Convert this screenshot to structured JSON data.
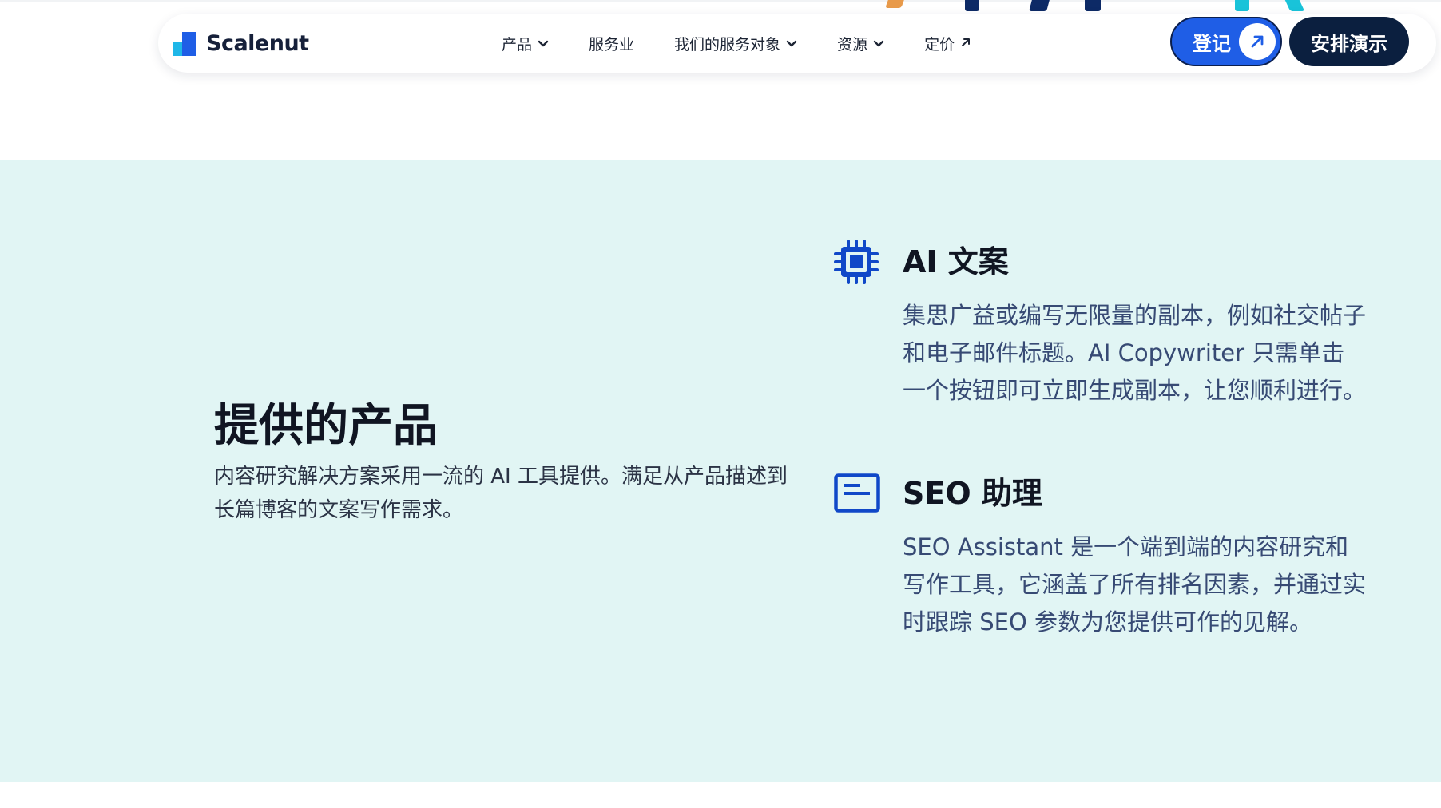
{
  "brand": {
    "name": "Scalenut",
    "accent": "#1f5ee6",
    "navy": "#0b1f3f",
    "section_bg": "#e1f5f4"
  },
  "nav": {
    "items": [
      {
        "label": "产品",
        "has_dropdown": true
      },
      {
        "label": "服务业",
        "has_dropdown": false
      },
      {
        "label": "我们的服务对象",
        "has_dropdown": true
      },
      {
        "label": "资源",
        "has_dropdown": true
      },
      {
        "label": "定价",
        "has_external_arrow": true
      }
    ],
    "login_label": "登记",
    "demo_label": "安排演示"
  },
  "section": {
    "title": "提供的产品",
    "description": "内容研究解决方案采用一流的 AI 工具提供。满足从产品描述到长篇博客的文案写作需求。",
    "features": [
      {
        "icon": "chip-icon",
        "title": "AI 文案",
        "description": "集思广益或编写无限量的副本，例如社交帖子和电子邮件标题。AI Copywriter 只需单击一个按钮即可立即生成副本，让您顺利进行。"
      },
      {
        "icon": "document-icon",
        "title": "SEO 助理",
        "description": "SEO Assistant 是一个端到端的内容研究和写作工具，它涵盖了所有排名因素，并通过实时跟踪 SEO 参数为您提供可作的见解。"
      }
    ]
  }
}
